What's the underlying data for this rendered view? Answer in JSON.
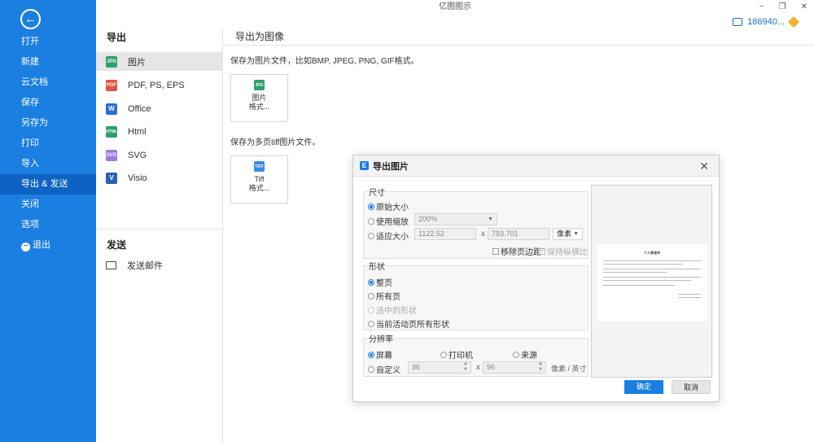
{
  "app": {
    "title": "亿图图示",
    "window_controls": [
      "−",
      "❐",
      "✕"
    ],
    "user_id": "186940...",
    "accent_color": "#1a7fe0"
  },
  "sidebar": {
    "back_icon": "arrow-left-icon",
    "items": [
      {
        "label": "打开"
      },
      {
        "label": "新建"
      },
      {
        "label": "云文档"
      },
      {
        "label": "保存"
      },
      {
        "label": "另存为"
      },
      {
        "label": "打印"
      },
      {
        "label": "导入"
      },
      {
        "label": "导出 & 发送",
        "active": true
      },
      {
        "label": "关闭"
      },
      {
        "label": "选项"
      },
      {
        "label": "退出"
      }
    ]
  },
  "middle": {
    "export_title": "导出",
    "export_items": [
      {
        "label": "图片",
        "icon": "JPG",
        "color": "#2e9e6e",
        "active": true
      },
      {
        "label": "PDF, PS, EPS",
        "icon": "PDF",
        "color": "#e0533f"
      },
      {
        "label": "Office",
        "icon": "W",
        "color": "#2b6cd4"
      },
      {
        "label": "Html",
        "icon": "HTML",
        "color": "#2e9e6e"
      },
      {
        "label": "SVG",
        "icon": "SVG",
        "color": "#9a7be0"
      },
      {
        "label": "Visio",
        "icon": "V",
        "color": "#2b5fb5"
      }
    ],
    "send_title": "发送",
    "send_item": "发送邮件"
  },
  "content": {
    "title": "导出为图像",
    "desc1": "保存为图片文件，比如BMP, JPEG, PNG, GIF格式。",
    "tile1": {
      "icon": "JPG",
      "line1": "图片",
      "line2": "格式..."
    },
    "desc2": "保存为多页tiff图片文件。",
    "tile2": {
      "icon": "TIFF",
      "line1": "Tiff",
      "line2": "格式..."
    }
  },
  "dialog": {
    "title": "导出图片",
    "size_group": {
      "label": "尺寸",
      "original": "原始大小",
      "scale": "使用缩放",
      "scale_value": "200%",
      "fit": "适应大小",
      "width": "1122.52",
      "times": "x",
      "height": "793.701",
      "unit": "像素",
      "remove_margin": "移除页边距",
      "keep_ratio": "保持纵横比"
    },
    "shape_group": {
      "label": "形状",
      "whole_page": "整页",
      "all_pages": "所有页",
      "selected": "选中的形状",
      "current_all": "当前活动页所有形状"
    },
    "resolution_group": {
      "label": "分辨率",
      "screen": "屏幕",
      "printer": "打印机",
      "source": "来源",
      "custom": "自定义",
      "dpi_x": "96",
      "times": "x",
      "dpi_y": "96",
      "unit": "像素 / 英寸"
    },
    "preview": {
      "page_title": "个人承诺书"
    },
    "ok": "确定",
    "cancel": "取消"
  }
}
